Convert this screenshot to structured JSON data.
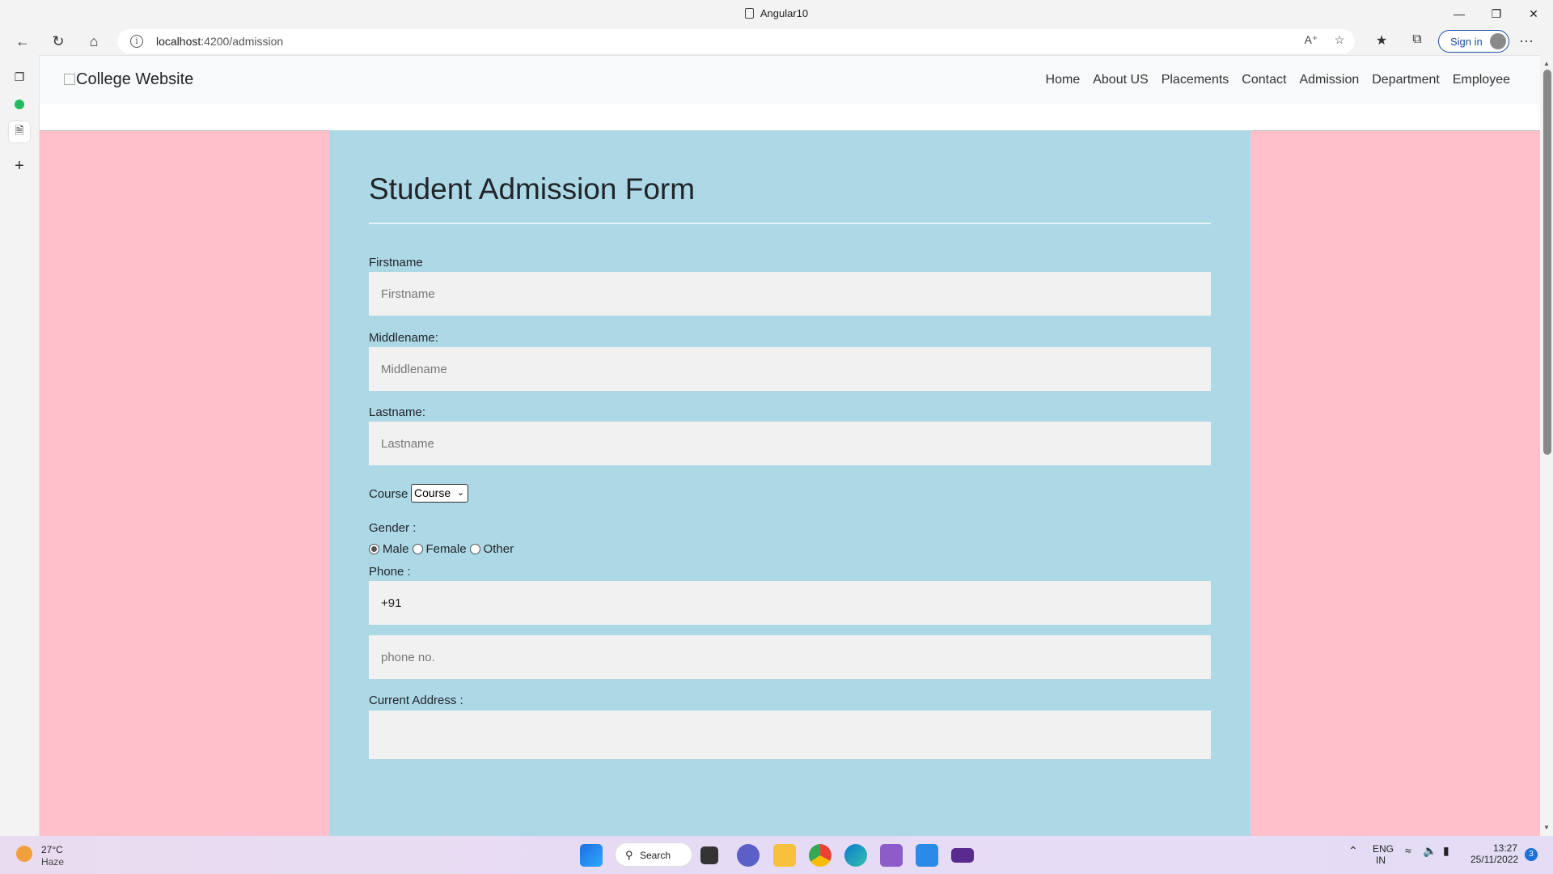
{
  "window": {
    "title": "Angular10",
    "minimize": "—",
    "restore": "❐",
    "close": "✕"
  },
  "browser": {
    "url_host": "localhost",
    "url_path": ":4200/admission",
    "sign_in_label": "Sign in",
    "more": "···"
  },
  "site": {
    "brand": "College Website",
    "menu": [
      "Home",
      "About US",
      "Placements",
      "Contact",
      "Admission",
      "Department",
      "Employee"
    ]
  },
  "form": {
    "heading": "Student Admission Form",
    "firstname_label": "Firstname",
    "firstname_placeholder": "Firstname",
    "middlename_label": "Middlename:",
    "middlename_placeholder": "Middlename",
    "lastname_label": "Lastname:",
    "lastname_placeholder": "Lastname",
    "course_label": "Course :",
    "course_selected": "Course",
    "gender_label": "Gender :",
    "genders": [
      "Male",
      "Female",
      "Other"
    ],
    "gender_selected": "Male",
    "phone_label": "Phone :",
    "phone_code": "+91",
    "phone_placeholder": "phone no.",
    "address_label": "Current Address :"
  },
  "taskbar": {
    "temperature": "27°C",
    "condition": "Haze",
    "search_label": "Search",
    "lang": "ENG",
    "region": "IN",
    "time": "13:27",
    "date": "25/11/2022",
    "notifications": "3"
  },
  "colors": {
    "page_bg": "#ffc0cb",
    "form_bg": "#add8e6",
    "input_bg": "#f1f1f1",
    "nav_bg": "#f8f9fa"
  }
}
